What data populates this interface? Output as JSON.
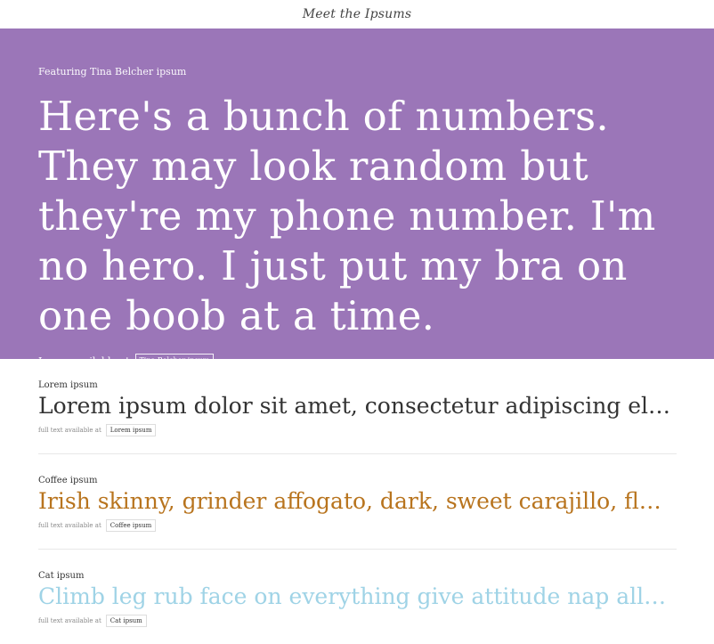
{
  "header": {
    "brand": "Meet the Ipsums"
  },
  "hero": {
    "featuring": "Featuring Tina Belcher ipsum",
    "quote": "Here's a bunch of numbers. They may look random but they're my phone number. I'm no hero. I just put my bra on one boob at a time.",
    "available_label": "Ipsum available at",
    "available_link": "Tina Belcher ipsum",
    "bg_color": "#9b76b8"
  },
  "items": [
    {
      "name": "Lorem ipsum",
      "sample": "Lorem ipsum dolor sit amet, consectetur adipiscing elit. Praesent",
      "meta": "full text available at",
      "link": "Lorem ipsum",
      "color": "#333333"
    },
    {
      "name": "Coffee ipsum",
      "sample": "Irish skinny, grinder affogato, dark, sweet carajillo, flavour seasonal",
      "meta": "full text available at",
      "link": "Coffee ipsum",
      "color": "#b8741e"
    },
    {
      "name": "Cat ipsum",
      "sample": "Climb leg rub face on everything give attitude nap all day for under",
      "meta": "full text available at",
      "link": "Cat ipsum",
      "color": "#9fd3e6"
    }
  ]
}
